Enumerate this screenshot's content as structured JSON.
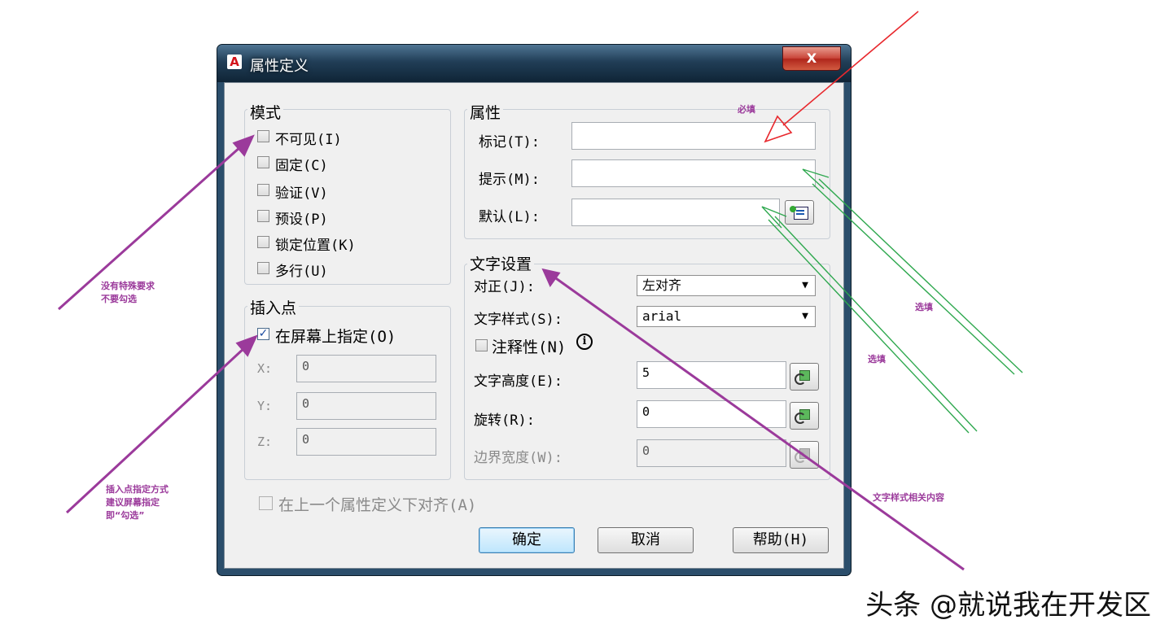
{
  "window": {
    "title": "属性定义",
    "close_label": "X"
  },
  "mode": {
    "legend": "模式",
    "items": [
      {
        "label": "不可见(I)",
        "checked": false
      },
      {
        "label": "固定(C)",
        "checked": false
      },
      {
        "label": "验证(V)",
        "checked": false
      },
      {
        "label": "预设(P)",
        "checked": false
      },
      {
        "label": "锁定位置(K)",
        "checked": false
      },
      {
        "label": "多行(U)",
        "checked": false
      }
    ]
  },
  "insert_point": {
    "legend": "插入点",
    "on_screen_label": "在屏幕上指定(O)",
    "on_screen_checked": true,
    "x_label": "X:",
    "x_value": "0",
    "y_label": "Y:",
    "y_value": "0",
    "z_label": "Z:",
    "z_value": "0"
  },
  "attribute": {
    "legend": "属性",
    "tag_label": "标记(T):",
    "tag_value": "",
    "prompt_label": "提示(M):",
    "prompt_value": "",
    "default_label": "默认(L):",
    "default_value": ""
  },
  "text_settings": {
    "legend": "文字设置",
    "justify_label": "对正(J):",
    "justify_value": "左对齐",
    "style_label": "文字样式(S):",
    "style_value": "arial",
    "annotative_label": "注释性(N)",
    "height_label": "文字高度(E):",
    "height_value": "5",
    "rotation_label": "旋转(R):",
    "rotation_value": "0",
    "boundary_label": "边界宽度(W):",
    "boundary_value": "0"
  },
  "align_below_label": "在上一个属性定义下对齐(A)",
  "buttons": {
    "ok": "确定",
    "cancel": "取消",
    "help": "帮助(H)"
  },
  "annotations": {
    "required": "必填",
    "optional_1": "选填",
    "optional_2": "选填",
    "mode_note": "没有特殊要求\n不要勾选",
    "insert_note": "插入点指定方式\n建议屏幕指定\n即“勾选”",
    "text_note": "文字样式相关内容"
  },
  "watermark": "头条 @就说我在开发区",
  "colors": {
    "red_arrow": "#e8282d",
    "green_arrow": "#2fa84f",
    "purple_arrow": "#9b3a9b"
  }
}
